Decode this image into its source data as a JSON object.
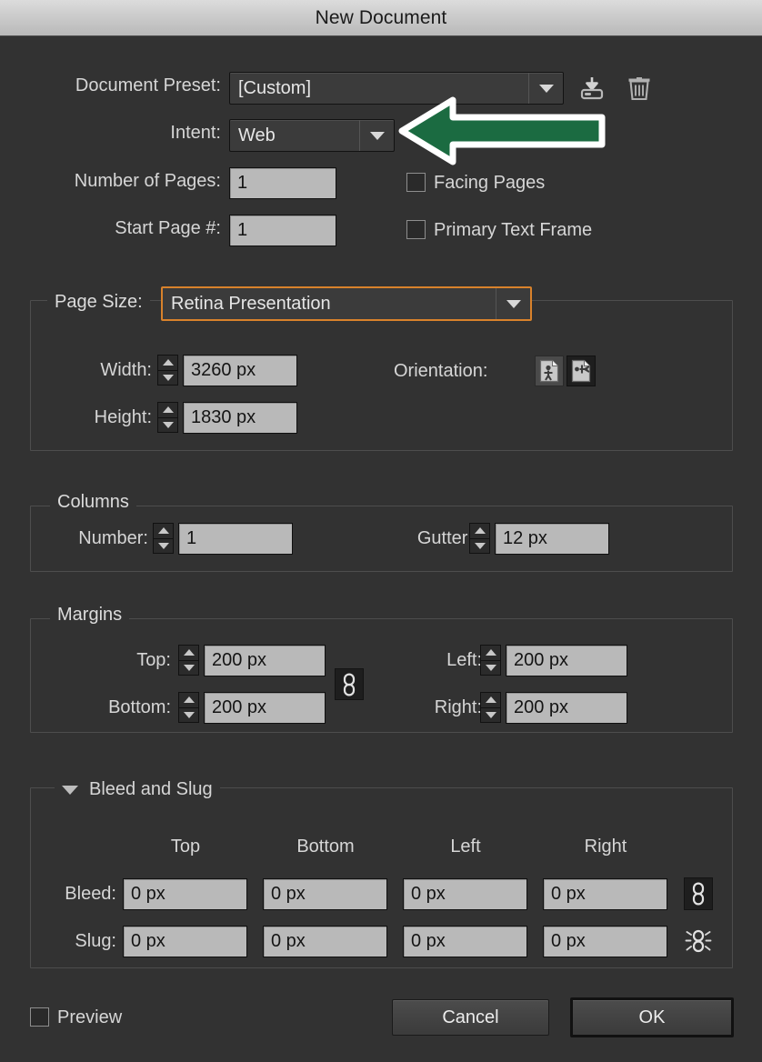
{
  "window": {
    "title": "New Document"
  },
  "preset": {
    "label": "Document Preset:",
    "value": "[Custom]",
    "save_icon": "save-preset-icon",
    "delete_icon": "trash-icon"
  },
  "intent": {
    "label": "Intent:",
    "value": "Web"
  },
  "pages": {
    "number_label": "Number of Pages:",
    "number_value": "1",
    "start_label": "Start Page #:",
    "start_value": "1",
    "facing_pages_label": "Facing Pages",
    "facing_pages_checked": false,
    "primary_text_frame_label": "Primary Text Frame",
    "primary_text_frame_checked": false
  },
  "page_size": {
    "label": "Page Size:",
    "value": "Retina Presentation",
    "focused": true,
    "width_label": "Width:",
    "width_value": "3260 px",
    "height_label": "Height:",
    "height_value": "1830 px",
    "orientation_label": "Orientation:",
    "orientation_portrait_icon": "portrait-orientation-icon",
    "orientation_landscape_icon": "landscape-orientation-icon",
    "orientation_selected": "landscape"
  },
  "columns": {
    "title": "Columns",
    "number_label": "Number:",
    "number_value": "1",
    "gutter_label": "Gutter:",
    "gutter_value": "12 px"
  },
  "margins": {
    "title": "Margins",
    "top_label": "Top:",
    "top_value": "200 px",
    "bottom_label": "Bottom:",
    "bottom_value": "200 px",
    "left_label": "Left:",
    "left_value": "200 px",
    "right_label": "Right:",
    "right_value": "200 px",
    "link_icon": "chain-link-icon"
  },
  "bleed_slug": {
    "title": "Bleed and Slug",
    "expanded": true,
    "disclosure_icon": "triangle-down-icon",
    "headers": [
      "Top",
      "Bottom",
      "Left",
      "Right"
    ],
    "bleed_label": "Bleed:",
    "bleed_values": [
      "0 px",
      "0 px",
      "0 px",
      "0 px"
    ],
    "bleed_link_icon": "chain-link-icon",
    "slug_label": "Slug:",
    "slug_values": [
      "0 px",
      "0 px",
      "0 px",
      "0 px"
    ],
    "slug_link_icon": "broken-chain-link-icon"
  },
  "footer": {
    "preview_label": "Preview",
    "preview_checked": false,
    "cancel_label": "Cancel",
    "ok_label": "OK"
  },
  "annotation": {
    "arrow_icon": "green-arrow-left-icon",
    "arrow_color": "#1b6b41",
    "arrow_outline": "#ffffff",
    "points_to": "Intent dropdown"
  },
  "colors": {
    "dialog_bg": "#323232",
    "titlebar_top": "#dcdcdc",
    "titlebar_bottom": "#b9b9b9",
    "input_bg": "#b9b9b9",
    "dropdown_bg": "#3b3b3b",
    "focus_ring": "#d9822b",
    "text": "#d6d6d6"
  }
}
